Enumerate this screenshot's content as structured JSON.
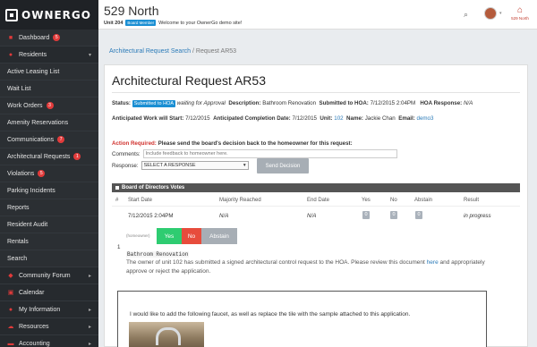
{
  "app": {
    "logo": "OWNERGO"
  },
  "topbar": {
    "property": "529 North",
    "unit": "Unit 204",
    "role": "Board Member",
    "welcome": "Welcome to your OwnerGo demo site!",
    "brand": "529 North"
  },
  "sidebar": {
    "items": [
      {
        "label": "Dashboard",
        "badge": "5",
        "icon": "home-icon"
      },
      {
        "label": "Residents",
        "icon": "users-icon",
        "caret": "▾"
      },
      {
        "label": "Active Leasing List"
      },
      {
        "label": "Wait List"
      },
      {
        "label": "Work Orders",
        "badge": "3"
      },
      {
        "label": "Amenity Reservations"
      },
      {
        "label": "Communications",
        "badge": "7"
      },
      {
        "label": "Architectural Requests",
        "badge": "1"
      },
      {
        "label": "Violations",
        "badge": "5"
      },
      {
        "label": "Parking Incidents"
      },
      {
        "label": "Reports"
      },
      {
        "label": "Resident Audit"
      },
      {
        "label": "Rentals"
      },
      {
        "label": "Search"
      },
      {
        "label": "Community Forum",
        "icon": "chat-icon",
        "caret": "▸"
      },
      {
        "label": "Calendar",
        "icon": "calendar-icon"
      },
      {
        "label": "My Information",
        "icon": "user-icon",
        "caret": "▸"
      },
      {
        "label": "Resources",
        "icon": "cloud-icon",
        "caret": "▸"
      },
      {
        "label": "Accounting",
        "icon": "money-icon",
        "caret": "▸"
      }
    ]
  },
  "breadcrumb": {
    "parent": "Architectural Request Search",
    "separator": "/",
    "current": "Request AR53"
  },
  "request": {
    "title": "Architectural Request AR53",
    "status_label": "Status:",
    "status": "Submitted to HOA",
    "status_note": "waiting for Approval",
    "description_label": "Description:",
    "description": "Bathroom Renovation",
    "submitted_label": "Submitted to HOA:",
    "submitted": "7/12/2015 2:04PM",
    "hoa_response_label": "HOA Response:",
    "hoa_response": "N/A",
    "start_label": "Anticipated Work will Start:",
    "start": "7/12/2015",
    "completion_label": "Anticipated Completion Date:",
    "completion": "7/12/2015",
    "unit_label": "Unit:",
    "unit": "102",
    "name_label": "Name:",
    "name": "Jackie Chan",
    "email_label": "Email:",
    "email": "demo3"
  },
  "action": {
    "required": "Action Required:",
    "message": "Please send the board's decision back to the homeowner for this request:",
    "comments_label": "Comments:",
    "comments_placeholder": "Include feedback to homeowner here.",
    "response_label": "Response:",
    "response_value": "SELECT A RESPONSE",
    "send_button": "Send Decision"
  },
  "votes": {
    "heading": "Board of Directors Votes",
    "columns": [
      "#",
      "Start Date",
      "Majority Reached",
      "End Date",
      "Yes",
      "No",
      "Abstain",
      "Result"
    ],
    "row": {
      "start": "7/12/2015 2:04PM",
      "majority": "N/A",
      "end": "N/A",
      "yes": "0",
      "no": "0",
      "abstain": "0",
      "result": "in progress"
    },
    "vote_as": "(homeowner)",
    "buttons": {
      "yes": "Yes",
      "no": "No",
      "abstain": "Abstain"
    },
    "colors": {
      "yes": "#2ecc71",
      "no": "#e74c3c",
      "abstain": "#a7aeb5"
    }
  },
  "attachment": {
    "index": "1",
    "tag": "Bathroom Renovation",
    "text_before": "The owner of unit 102 has submitted a signed architectural control request to the HOA. Please review this document",
    "link": "here",
    "text_after": "and appropriately approve or reject the application.",
    "doc_text": "I would like to add the following faucet, as well as replace the tile with the sample attached to this application."
  }
}
